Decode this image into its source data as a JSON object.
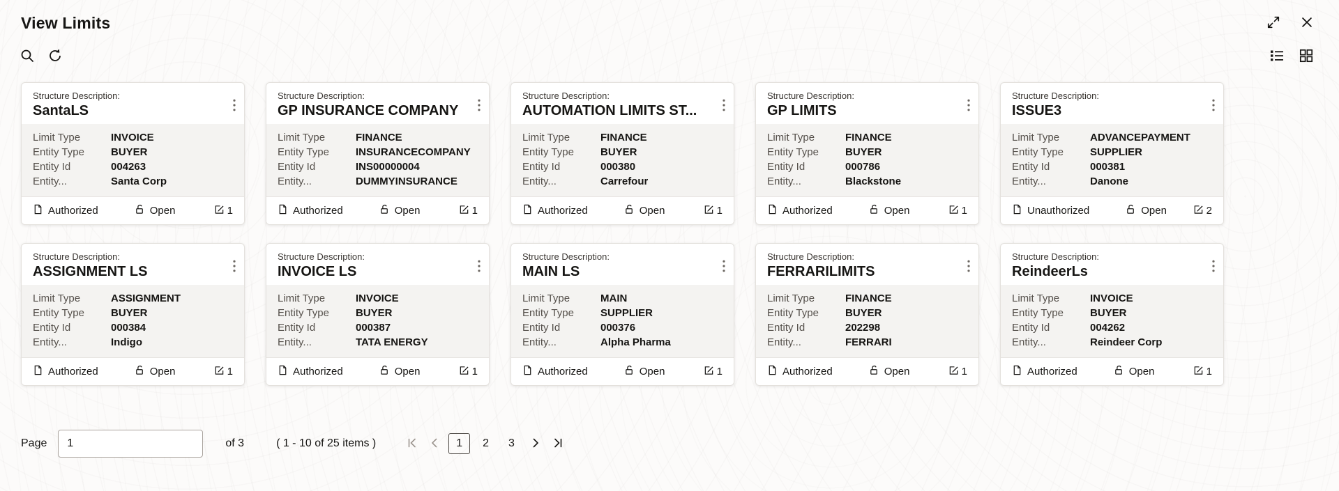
{
  "window": {
    "title": "View Limits"
  },
  "card_labels": {
    "structure_description": "Structure Description:",
    "limit_type": "Limit Type",
    "entity_type": "Entity Type",
    "entity_id": "Entity Id",
    "entity": "Entity..."
  },
  "cards": [
    {
      "structure_description": "SantaLS",
      "limit_type": "INVOICE",
      "entity_type": "BUYER",
      "entity_id": "004263",
      "entity": "Santa Corp",
      "auth_status": "Authorized",
      "record_status": "Open",
      "edit_count": "1"
    },
    {
      "structure_description": "GP INSURANCE COMPANY",
      "limit_type": "FINANCE",
      "entity_type": "INSURANCECOMPANY",
      "entity_id": "INS00000004",
      "entity": "DUMMYINSURANCE",
      "auth_status": "Authorized",
      "record_status": "Open",
      "edit_count": "1"
    },
    {
      "structure_description": "AUTOMATION LIMITS ST...",
      "limit_type": "FINANCE",
      "entity_type": "BUYER",
      "entity_id": "000380",
      "entity": "Carrefour",
      "auth_status": "Authorized",
      "record_status": "Open",
      "edit_count": "1"
    },
    {
      "structure_description": "GP LIMITS",
      "limit_type": "FINANCE",
      "entity_type": "BUYER",
      "entity_id": "000786",
      "entity": "Blackstone",
      "auth_status": "Authorized",
      "record_status": "Open",
      "edit_count": "1"
    },
    {
      "structure_description": "ISSUE3",
      "limit_type": "ADVANCEPAYMENT",
      "entity_type": "SUPPLIER",
      "entity_id": "000381",
      "entity": "Danone",
      "auth_status": "Unauthorized",
      "record_status": "Open",
      "edit_count": "2"
    },
    {
      "structure_description": "ASSIGNMENT LS",
      "limit_type": "ASSIGNMENT",
      "entity_type": "BUYER",
      "entity_id": "000384",
      "entity": "Indigo",
      "auth_status": "Authorized",
      "record_status": "Open",
      "edit_count": "1"
    },
    {
      "structure_description": "INVOICE LS",
      "limit_type": "INVOICE",
      "entity_type": "BUYER",
      "entity_id": "000387",
      "entity": "TATA ENERGY",
      "auth_status": "Authorized",
      "record_status": "Open",
      "edit_count": "1"
    },
    {
      "structure_description": "MAIN LS",
      "limit_type": "MAIN",
      "entity_type": "SUPPLIER",
      "entity_id": "000376",
      "entity": "Alpha Pharma",
      "auth_status": "Authorized",
      "record_status": "Open",
      "edit_count": "1"
    },
    {
      "structure_description": "FERRARILIMITS",
      "limit_type": "FINANCE",
      "entity_type": "BUYER",
      "entity_id": "202298",
      "entity": "FERRARI",
      "auth_status": "Authorized",
      "record_status": "Open",
      "edit_count": "1"
    },
    {
      "structure_description": "ReindeerLs",
      "limit_type": "INVOICE",
      "entity_type": "BUYER",
      "entity_id": "004262",
      "entity": "Reindeer Corp",
      "auth_status": "Authorized",
      "record_status": "Open",
      "edit_count": "1"
    }
  ],
  "pagination": {
    "page_label": "Page",
    "page_input_value": "1",
    "of_text": "of 3",
    "items_summary": "( 1 - 10 of 25 items )",
    "pages": [
      "1",
      "2",
      "3"
    ],
    "current_page": "1"
  },
  "icons": {
    "search": "magnifier",
    "refresh": "circular-arrow",
    "list_view": "list-rows",
    "grid_view": "four-squares",
    "fullscreen_toggle": "diagonal-arrows",
    "close": "x-mark",
    "card_menu": "kebab-vertical-dots",
    "authorized": "document",
    "open": "open-padlock",
    "edits": "edit-pencil-square",
    "pager_first": "bar-chevron-left",
    "pager_prev": "chevron-left",
    "pager_next": "chevron-right",
    "pager_last": "chevron-right-bar"
  },
  "colors": {
    "text_primary": "#161513",
    "text_secondary": "#55504b",
    "card_body_bg": "#f4f3f1",
    "card_border": "#e4e1dd",
    "disabled": "#9b948e"
  }
}
